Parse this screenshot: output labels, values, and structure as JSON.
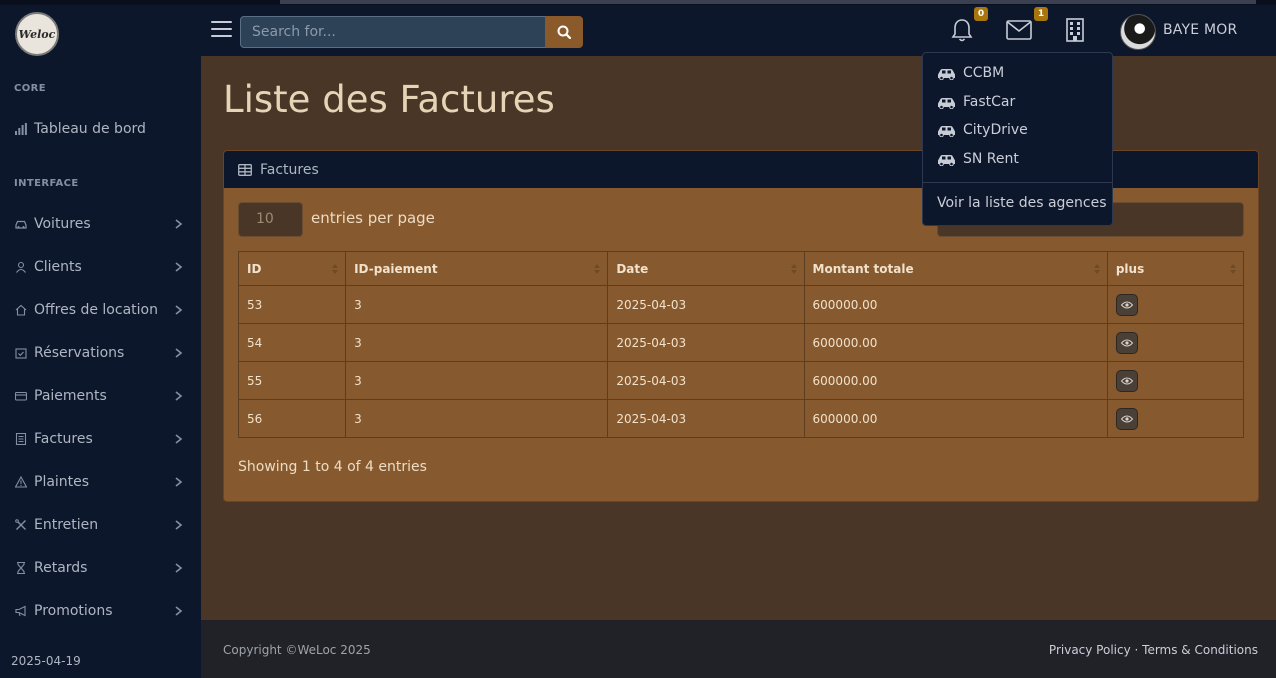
{
  "app": {
    "logo_text": "Weloc",
    "search_placeholder": "Search for...",
    "user_name": "BAYE MOR"
  },
  "badges": {
    "alerts_count": "0",
    "messages_count": "1"
  },
  "sidebar": {
    "core_heading": "CORE",
    "dashboard_label": "Tableau de bord",
    "interface_heading": "INTERFACE",
    "items": [
      {
        "label": "Voitures",
        "icon": "car-icon"
      },
      {
        "label": "Clients",
        "icon": "user-icon"
      },
      {
        "label": "Offres de location",
        "icon": "home-icon"
      },
      {
        "label": "Réservations",
        "icon": "calendar-check-icon"
      },
      {
        "label": "Paiements",
        "icon": "credit-card-icon"
      },
      {
        "label": "Factures",
        "icon": "receipt-icon"
      },
      {
        "label": "Plaintes",
        "icon": "warning-icon"
      },
      {
        "label": "Entretien",
        "icon": "tools-icon"
      },
      {
        "label": "Retards",
        "icon": "hourglass-icon"
      },
      {
        "label": "Promotions",
        "icon": "megaphone-icon"
      }
    ],
    "date": "2025-04-19"
  },
  "page": {
    "title": "Liste des Factures",
    "card_title": "Factures",
    "per_page_value": "10",
    "per_page_label": "entries per page",
    "showing_text": "Showing 1 to 4 of 4 entries"
  },
  "table": {
    "headers": [
      "ID",
      "ID-paiement",
      "Date",
      "Montant totale",
      "plus"
    ],
    "rows": [
      [
        "53",
        "3",
        "2025-04-03",
        "600000.00"
      ],
      [
        "54",
        "3",
        "2025-04-03",
        "600000.00"
      ],
      [
        "55",
        "3",
        "2025-04-03",
        "600000.00"
      ],
      [
        "56",
        "3",
        "2025-04-03",
        "600000.00"
      ]
    ]
  },
  "dropdown": {
    "agencies": [
      "CCBM",
      "FastCar",
      "CityDrive",
      "SN Rent"
    ],
    "view_all_label": "Voir la liste des agences"
  },
  "footer": {
    "copyright": "Copyright ©WeLoc 2025",
    "privacy_label": "Privacy Policy",
    "separator": " · ",
    "terms_label": "Terms & Conditions"
  },
  "colors": {
    "sidebar_bg": "#0d172b",
    "main_bg": "#4a3626",
    "card_bg": "#87592e",
    "accent": "#8b5a2b",
    "badge": "#a8760c"
  }
}
